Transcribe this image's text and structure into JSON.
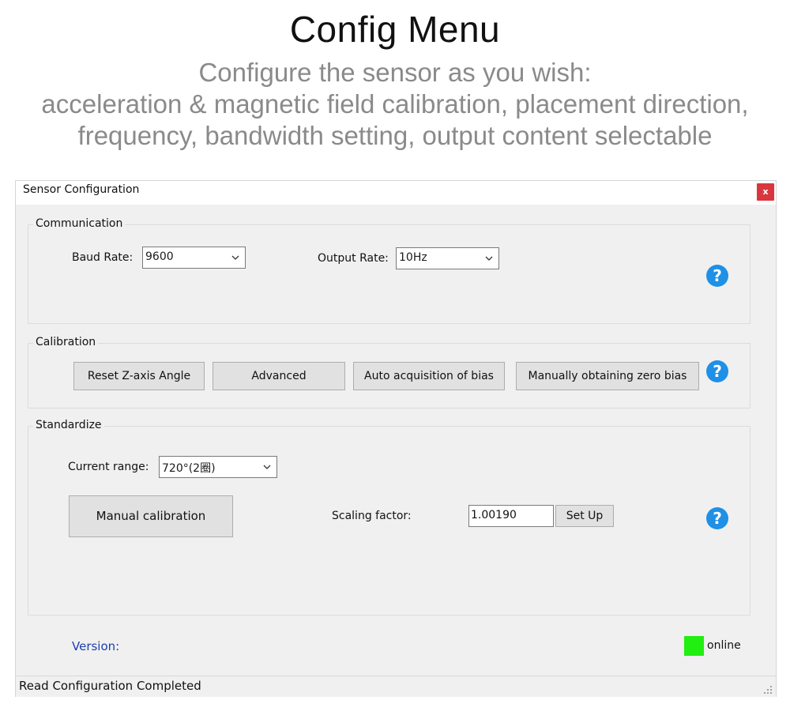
{
  "hero": {
    "title": "Config Menu",
    "subtitle_lines": [
      "Configure the sensor as you wish:",
      "acceleration & magnetic field calibration, placement direction,",
      "frequency, bandwidth setting, output content selectable"
    ]
  },
  "window": {
    "title": "Sensor Configuration",
    "close_label": "x"
  },
  "communication": {
    "group_label": "Communication",
    "baud_rate_label": "Baud Rate:",
    "baud_rate_value": "9600",
    "output_rate_label": "Output Rate:",
    "output_rate_value": "10Hz",
    "help_label": "?"
  },
  "calibration": {
    "group_label": "Calibration",
    "buttons": [
      "Reset Z-axis Angle",
      "Advanced",
      "Auto acquisition of bias",
      "Manually obtaining zero bias"
    ],
    "help_label": "?"
  },
  "standardize": {
    "group_label": "Standardize",
    "current_range_label": "Current range:",
    "current_range_value": "720°(2圈)",
    "manual_calibration_label": "Manual calibration",
    "scaling_factor_label": "Scaling factor:",
    "scaling_factor_value": "1.00190",
    "set_up_label": "Set Up",
    "help_label": "?"
  },
  "footer": {
    "version_label": "Version:",
    "online_label": "online",
    "online_color": "#22ee11",
    "version_color": "#1a3fb0"
  },
  "status_bar": {
    "text": "Read Configuration Completed"
  },
  "colors": {
    "help_icon": "#1e90e6",
    "close_button": "#d9363e"
  }
}
